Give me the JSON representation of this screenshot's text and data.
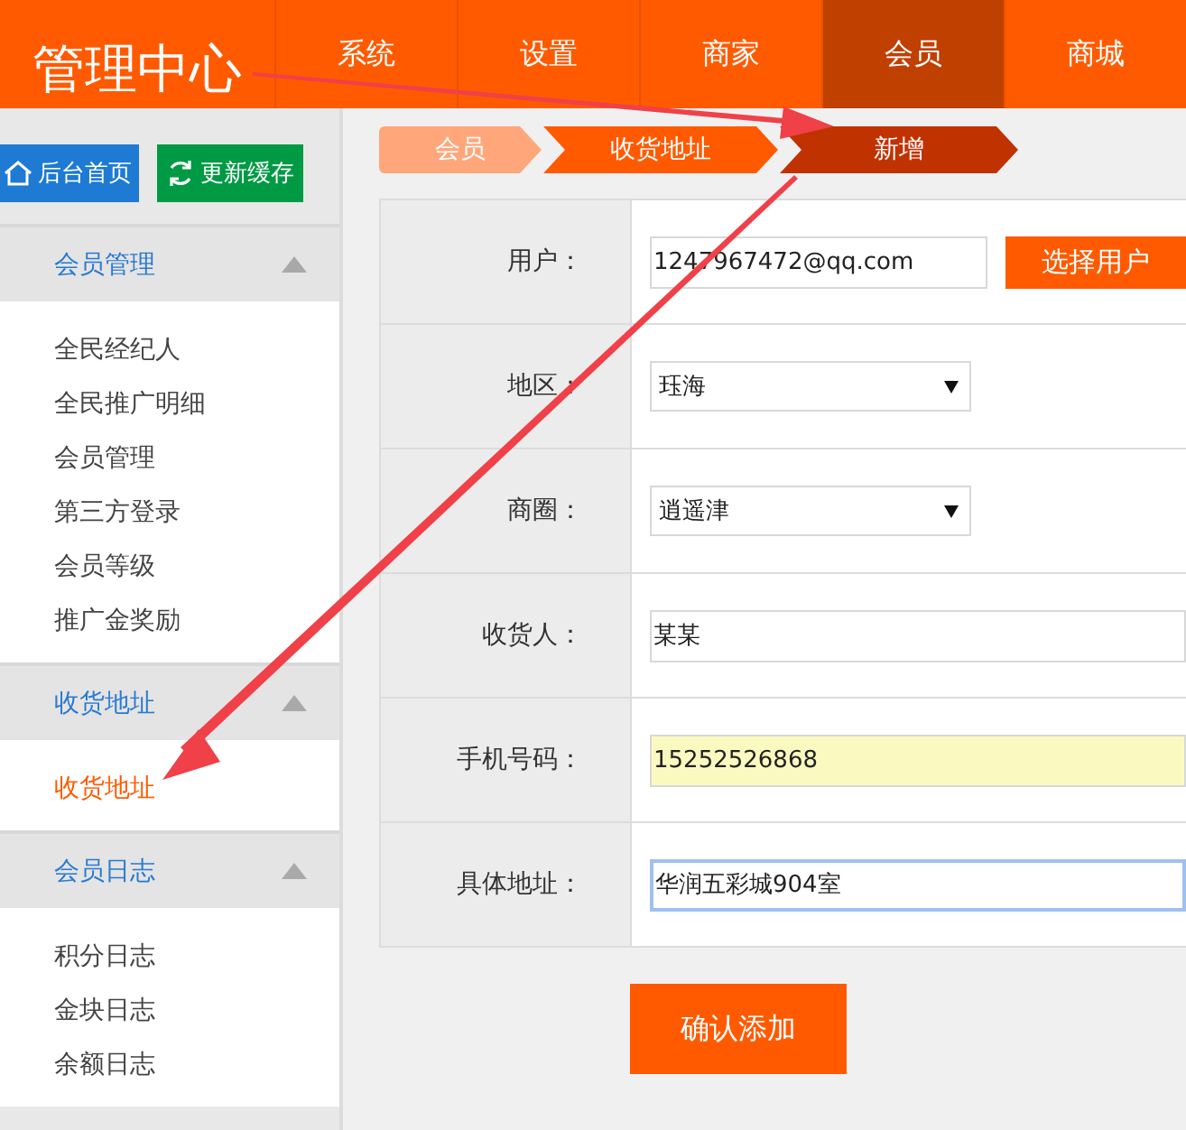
{
  "header": {
    "title": "管理中心"
  },
  "nav": [
    {
      "label": "系统",
      "selected": false
    },
    {
      "label": "设置",
      "selected": false
    },
    {
      "label": "商家",
      "selected": false
    },
    {
      "label": "会员",
      "selected": true
    },
    {
      "label": "商城",
      "selected": false
    }
  ],
  "quick_buttons": [
    {
      "kind": "home",
      "label": "后台首页"
    },
    {
      "kind": "refresh",
      "label": "更新缓存"
    }
  ],
  "sidebar": [
    {
      "title": "会员管理",
      "expanded": true,
      "items": [
        {
          "label": "全民经纪人",
          "selected": false
        },
        {
          "label": "全民推广明细",
          "selected": false
        },
        {
          "label": "会员管理",
          "selected": false
        },
        {
          "label": "第三方登录",
          "selected": false
        },
        {
          "label": "会员等级",
          "selected": false
        },
        {
          "label": "推广金奖励",
          "selected": false
        }
      ]
    },
    {
      "title": "收货地址",
      "expanded": true,
      "items": [
        {
          "label": "收货地址",
          "selected": true
        }
      ]
    },
    {
      "title": "会员日志",
      "expanded": true,
      "items": [
        {
          "label": "积分日志",
          "selected": false
        },
        {
          "label": "金块日志",
          "selected": false
        },
        {
          "label": "余额日志",
          "selected": false
        }
      ]
    }
  ],
  "breadcrumb": [
    {
      "label": "会员",
      "kind": "first"
    },
    {
      "label": "收货地址",
      "kind": "middle"
    },
    {
      "label": "新增",
      "kind": "current"
    }
  ],
  "form": [
    {
      "label": "用户：",
      "kind": "input",
      "value": "1247967472@qq.com",
      "autofilled": false,
      "focused": false,
      "button": "选择用户"
    },
    {
      "label": "地区：",
      "kind": "select",
      "value": "珏海",
      "autofilled": false,
      "focused": false
    },
    {
      "label": "商圈：",
      "kind": "select",
      "value": "逍遥津",
      "autofilled": false,
      "focused": false
    },
    {
      "label": "收货人：",
      "kind": "input",
      "value": "某某",
      "autofilled": false,
      "focused": false
    },
    {
      "label": "手机号码：",
      "kind": "input",
      "value": "15252526868",
      "autofilled": true,
      "focused": false
    },
    {
      "label": "具体地址：",
      "kind": "input",
      "value": "华润五彩城904室",
      "autofilled": false,
      "focused": true
    }
  ],
  "submit": "确认添加"
}
